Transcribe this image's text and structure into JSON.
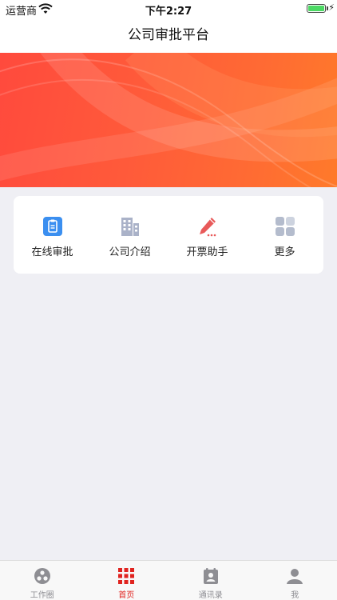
{
  "status_bar": {
    "carrier": "运营商",
    "time": "下午2:27"
  },
  "nav": {
    "title": "公司审批平台"
  },
  "menu": {
    "items": [
      {
        "label": "在线审批",
        "icon": "clipboard-icon"
      },
      {
        "label": "公司介绍",
        "icon": "building-icon"
      },
      {
        "label": "开票助手",
        "icon": "pencil-icon"
      },
      {
        "label": "更多",
        "icon": "grid-icon"
      }
    ]
  },
  "tabs": {
    "items": [
      {
        "label": "工作圈",
        "icon": "circle-group-icon"
      },
      {
        "label": "首页",
        "icon": "home-grid-icon"
      },
      {
        "label": "通讯录",
        "icon": "contacts-icon"
      },
      {
        "label": "我",
        "icon": "person-icon"
      }
    ],
    "active_index": 1
  },
  "colors": {
    "accent": "#e0231f",
    "banner_start": "#ff4a3d",
    "banner_end": "#ff7a2a",
    "clipboard": "#3b8ff0",
    "building": "#aab2c8",
    "pencil": "#e85a5a",
    "grid": "#b4bccd",
    "tab_inactive": "#8e8e93"
  }
}
